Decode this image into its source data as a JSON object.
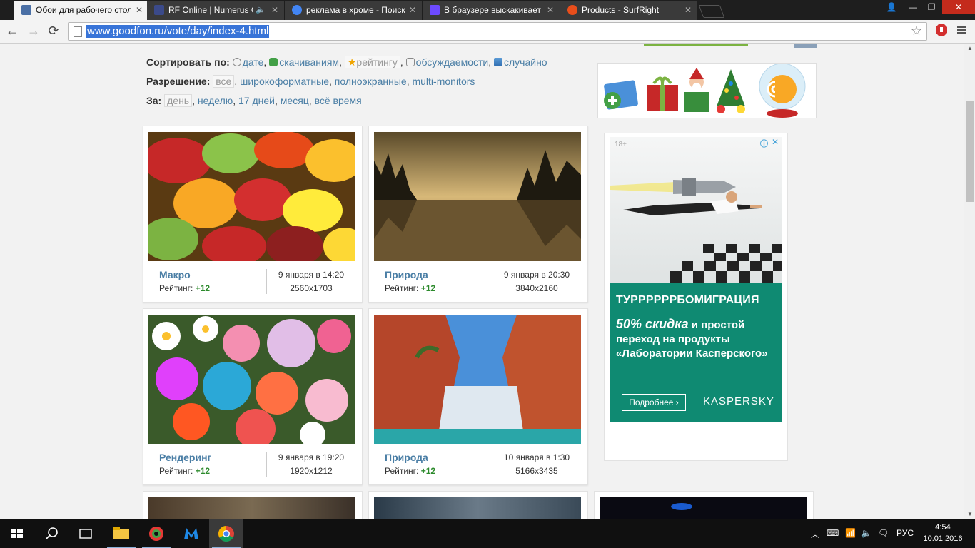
{
  "browser": {
    "tabs": [
      {
        "title": "Обои для рабочего стола",
        "active": true,
        "favicon_color": "#4a6fa5"
      },
      {
        "title": "RF Online | Numerus Co",
        "active": false,
        "favicon_color": "#3b4a8a",
        "audio": true
      },
      {
        "title": "реклама в хроме - Поиск",
        "active": false,
        "favicon_color": "#4285f4"
      },
      {
        "title": "В браузере выскакивает",
        "active": false,
        "favicon_color": "#6d4aff"
      },
      {
        "title": "Products - SurfRight",
        "active": false,
        "favicon_color": "#e94e1b"
      }
    ],
    "window_controls": {
      "user": "👤",
      "minimize": "—",
      "maximize": "❐",
      "close": "✕"
    },
    "url": "www.goodfon.ru/vote/day/index-4.html",
    "back": "←",
    "forward": "→",
    "reload": "⟳",
    "bookmark_star": "☆"
  },
  "page": {
    "sort": {
      "label": "Сортировать по:",
      "options": [
        {
          "text": "дате",
          "icon": "clock-icon",
          "sep": ", "
        },
        {
          "text": "скачиваниям",
          "icon": "download-icon",
          "sep": ", "
        },
        {
          "text": "рейтингу",
          "icon": "star-icon",
          "selected": true,
          "sep": ", "
        },
        {
          "text": "обсуждаемости",
          "icon": "comment-icon",
          "sep": ", "
        },
        {
          "text": "случайно",
          "icon": "random-icon",
          "sep": ""
        }
      ]
    },
    "resolution": {
      "label": "Разрешение:",
      "options": [
        {
          "text": "все",
          "selected": true,
          "sep": ", "
        },
        {
          "text": "широкоформатные",
          "sep": ", "
        },
        {
          "text": "полноэкранные",
          "sep": ", "
        },
        {
          "text": "multi-monitors",
          "sep": ""
        }
      ]
    },
    "period": {
      "label": "За:",
      "options": [
        {
          "text": "день",
          "selected": true,
          "sep": ", "
        },
        {
          "text": "неделю",
          "sep": ", "
        },
        {
          "text": "17 дней",
          "sep": ", "
        },
        {
          "text": "месяц",
          "sep": ", "
        },
        {
          "text": "всё время",
          "sep": ""
        }
      ]
    },
    "wallpapers": [
      {
        "category": "Макро",
        "rating_label": "Рейтинг:",
        "rating": "+12",
        "date": "9 января в 14:20",
        "resolution": "2560x1703"
      },
      {
        "category": "Природа",
        "rating_label": "Рейтинг:",
        "rating": "+12",
        "date": "9 января в 20:30",
        "resolution": "3840x2160"
      },
      {
        "category": "Рендеринг",
        "rating_label": "Рейтинг:",
        "rating": "+12",
        "date": "9 января в 19:20",
        "resolution": "1920x1212"
      },
      {
        "category": "Природа",
        "rating_label": "Рейтинг:",
        "rating": "+12",
        "date": "10 января в 1:30",
        "resolution": "5166x3435"
      }
    ],
    "ad": {
      "age": "18+",
      "headline": "ТУРРРРРРБОМИГРАЦИЯ",
      "discount": "50% скидка",
      "text_rest": " и  простой переход на продукты «Лаборатории Касперского»",
      "button": "Подробнее",
      "brand": "KASPERSKY"
    }
  },
  "taskbar": {
    "language": "РУС",
    "time": "4:54",
    "date": "10.01.2016"
  }
}
